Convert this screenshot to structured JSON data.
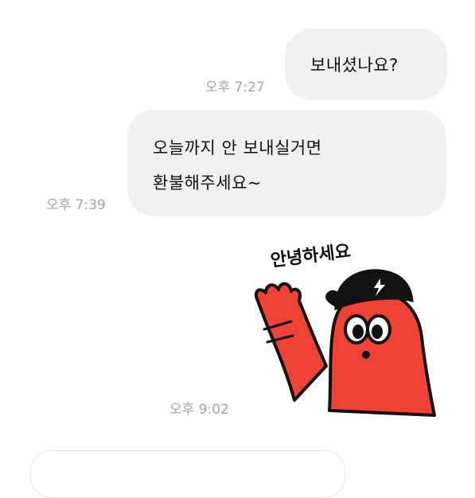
{
  "messages": [
    {
      "text": "보내셨나요?",
      "time": "오후 7:27"
    },
    {
      "lines": [
        "오늘까지 안 보내실거면",
        "환불해주세요~"
      ],
      "time": "오후 7:39"
    }
  ],
  "sticker": {
    "text": "안녕하세요",
    "time": "오후 9:02",
    "character_color": "#ef4135"
  },
  "colors": {
    "bubble": "#f1f1f1",
    "timestamp": "#a5a5a5"
  }
}
